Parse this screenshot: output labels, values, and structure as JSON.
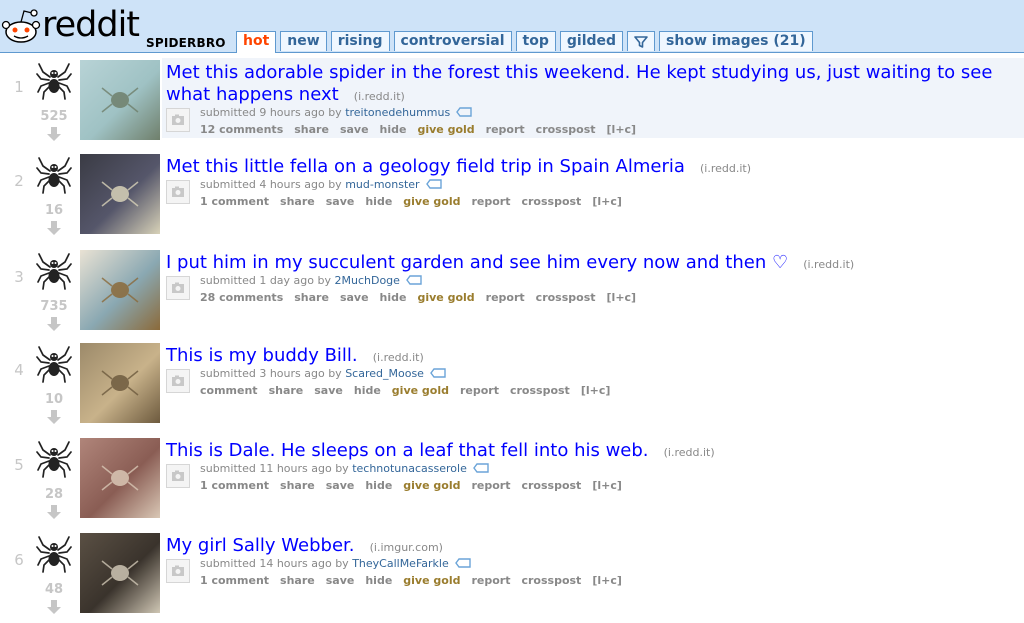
{
  "header": {
    "logo_text": "reddit",
    "subreddit": "SPIDERBRO",
    "tabs": [
      "hot",
      "new",
      "rising",
      "controversial",
      "top",
      "gilded"
    ],
    "filter_icon": "funnel-icon",
    "show_images_label": "show images (21)",
    "accent_color": "#ff4500",
    "header_bg": "#cee3f8"
  },
  "button_labels": {
    "share": "share",
    "save": "save",
    "hide": "hide",
    "give_gold": "give gold",
    "report": "report",
    "crosspost": "crosspost",
    "src": "[l+c]"
  },
  "posts": [
    {
      "rank": "1",
      "score": "525",
      "title": "Met this adorable spider in the forest this weekend. He kept studying us, just waiting to see what happens next",
      "domain": "(i.redd.it)",
      "submitted": "submitted 9 hours ago by ",
      "author": "treitonedehummus",
      "comments": "12 comments"
    },
    {
      "rank": "2",
      "score": "16",
      "title": "Met this little fella on a geology field trip in Spain Almeria",
      "domain": "(i.redd.it)",
      "submitted": "submitted 4 hours ago by ",
      "author": "mud-monster",
      "comments": "1 comment"
    },
    {
      "rank": "3",
      "score": "735",
      "title": "I put him in my succulent garden and see him every now and then ♡",
      "domain": "(i.redd.it)",
      "submitted": "submitted 1 day ago by ",
      "author": "2MuchDoge",
      "comments": "28 comments"
    },
    {
      "rank": "4",
      "score": "10",
      "title": "This is my buddy Bill.",
      "domain": "(i.redd.it)",
      "submitted": "submitted 3 hours ago by ",
      "author": "Scared_Moose",
      "comments": "comment"
    },
    {
      "rank": "5",
      "score": "28",
      "title": "This is Dale. He sleeps on a leaf that fell into his web.",
      "domain": "(i.redd.it)",
      "submitted": "submitted 11 hours ago by ",
      "author": "technotunacasserole",
      "comments": "1 comment"
    },
    {
      "rank": "6",
      "score": "48",
      "title": "My girl Sally Webber.",
      "domain": "(i.imgur.com)",
      "submitted": "submitted 14 hours ago by ",
      "author": "TheyCallMeFarkle",
      "comments": "1 comment"
    }
  ]
}
